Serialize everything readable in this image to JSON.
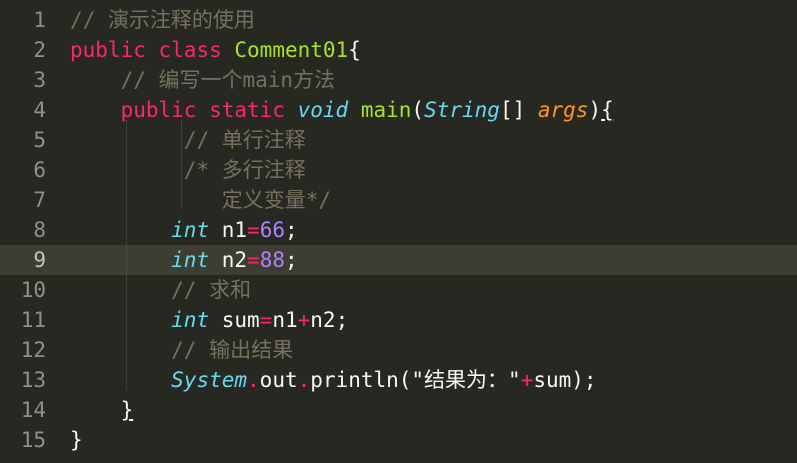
{
  "colors": {
    "background": "#272822",
    "active_line": "#3e3d32",
    "keyword": "#f92672",
    "class_name": "#a6e22e",
    "comment": "#75715e",
    "type": "#66d9ef",
    "number": "#ae81ff",
    "argument": "#fd971f",
    "plain": "#f8f8f2",
    "line_number": "#90908a"
  },
  "editor": {
    "active_line": 9,
    "lines": [
      {
        "n": "1",
        "tokens": [
          {
            "t": "// 演示注释的使用",
            "c": "cmt"
          }
        ]
      },
      {
        "n": "2",
        "tokens": [
          {
            "t": "public",
            "c": "kw"
          },
          {
            "t": " ",
            "c": "plain"
          },
          {
            "t": "class",
            "c": "kw"
          },
          {
            "t": " ",
            "c": "plain"
          },
          {
            "t": "Comment01",
            "c": "cls"
          },
          {
            "t": "{",
            "c": "plain"
          }
        ]
      },
      {
        "n": "3",
        "tokens": [
          {
            "t": "    ",
            "c": "plain"
          },
          {
            "t": "// 编写一个main方法",
            "c": "cmt"
          }
        ]
      },
      {
        "n": "4",
        "tokens": [
          {
            "t": "    ",
            "c": "plain"
          },
          {
            "t": "public",
            "c": "kw"
          },
          {
            "t": " ",
            "c": "plain"
          },
          {
            "t": "static",
            "c": "kw"
          },
          {
            "t": " ",
            "c": "plain"
          },
          {
            "t": "void",
            "c": "type"
          },
          {
            "t": " ",
            "c": "plain"
          },
          {
            "t": "main",
            "c": "fn"
          },
          {
            "t": "(",
            "c": "plain"
          },
          {
            "t": "String",
            "c": "type"
          },
          {
            "t": "[] ",
            "c": "plain"
          },
          {
            "t": "args",
            "c": "arg"
          },
          {
            "t": ")",
            "c": "plain"
          },
          {
            "t": "{",
            "c": "plain",
            "u": true
          }
        ]
      },
      {
        "n": "5",
        "tokens": [
          {
            "t": "         ",
            "c": "plain"
          },
          {
            "t": "// 单行注释",
            "c": "cmt"
          }
        ]
      },
      {
        "n": "6",
        "tokens": [
          {
            "t": "         ",
            "c": "plain"
          },
          {
            "t": "/* 多行注释",
            "c": "cmt"
          }
        ]
      },
      {
        "n": "7",
        "tokens": [
          {
            "t": "            ",
            "c": "plain"
          },
          {
            "t": "定义变量*/",
            "c": "cmt"
          }
        ]
      },
      {
        "n": "8",
        "tokens": [
          {
            "t": "        ",
            "c": "plain"
          },
          {
            "t": "int",
            "c": "type"
          },
          {
            "t": " n1",
            "c": "plain"
          },
          {
            "t": "=",
            "c": "op"
          },
          {
            "t": "66",
            "c": "num-lit"
          },
          {
            "t": ";",
            "c": "plain"
          }
        ]
      },
      {
        "n": "9",
        "tokens": [
          {
            "t": "        ",
            "c": "plain"
          },
          {
            "t": "int",
            "c": "type"
          },
          {
            "t": " n2",
            "c": "plain"
          },
          {
            "t": "=",
            "c": "op"
          },
          {
            "t": "88",
            "c": "num-lit"
          },
          {
            "t": ";",
            "c": "plain"
          }
        ]
      },
      {
        "n": "10",
        "tokens": [
          {
            "t": "        ",
            "c": "plain"
          },
          {
            "t": "// 求和",
            "c": "cmt"
          }
        ]
      },
      {
        "n": "11",
        "tokens": [
          {
            "t": "        ",
            "c": "plain"
          },
          {
            "t": "int",
            "c": "type"
          },
          {
            "t": " sum",
            "c": "plain"
          },
          {
            "t": "=",
            "c": "op"
          },
          {
            "t": "n1",
            "c": "plain"
          },
          {
            "t": "+",
            "c": "op"
          },
          {
            "t": "n2;",
            "c": "plain"
          }
        ]
      },
      {
        "n": "12",
        "tokens": [
          {
            "t": "        ",
            "c": "plain"
          },
          {
            "t": "// 输出结果",
            "c": "cmt"
          }
        ]
      },
      {
        "n": "13",
        "tokens": [
          {
            "t": "        ",
            "c": "plain"
          },
          {
            "t": "System",
            "c": "type"
          },
          {
            "t": ".",
            "c": "op"
          },
          {
            "t": "out",
            "c": "plain"
          },
          {
            "t": ".",
            "c": "op"
          },
          {
            "t": "println(\"结果为：\"",
            "c": "plain"
          },
          {
            "t": "+",
            "c": "op"
          },
          {
            "t": "sum);",
            "c": "plain"
          }
        ]
      },
      {
        "n": "14",
        "tokens": [
          {
            "t": "    ",
            "c": "plain"
          },
          {
            "t": "}",
            "c": "plain",
            "u": true
          }
        ]
      },
      {
        "n": "15",
        "tokens": [
          {
            "t": "}",
            "c": "plain"
          }
        ]
      }
    ]
  }
}
